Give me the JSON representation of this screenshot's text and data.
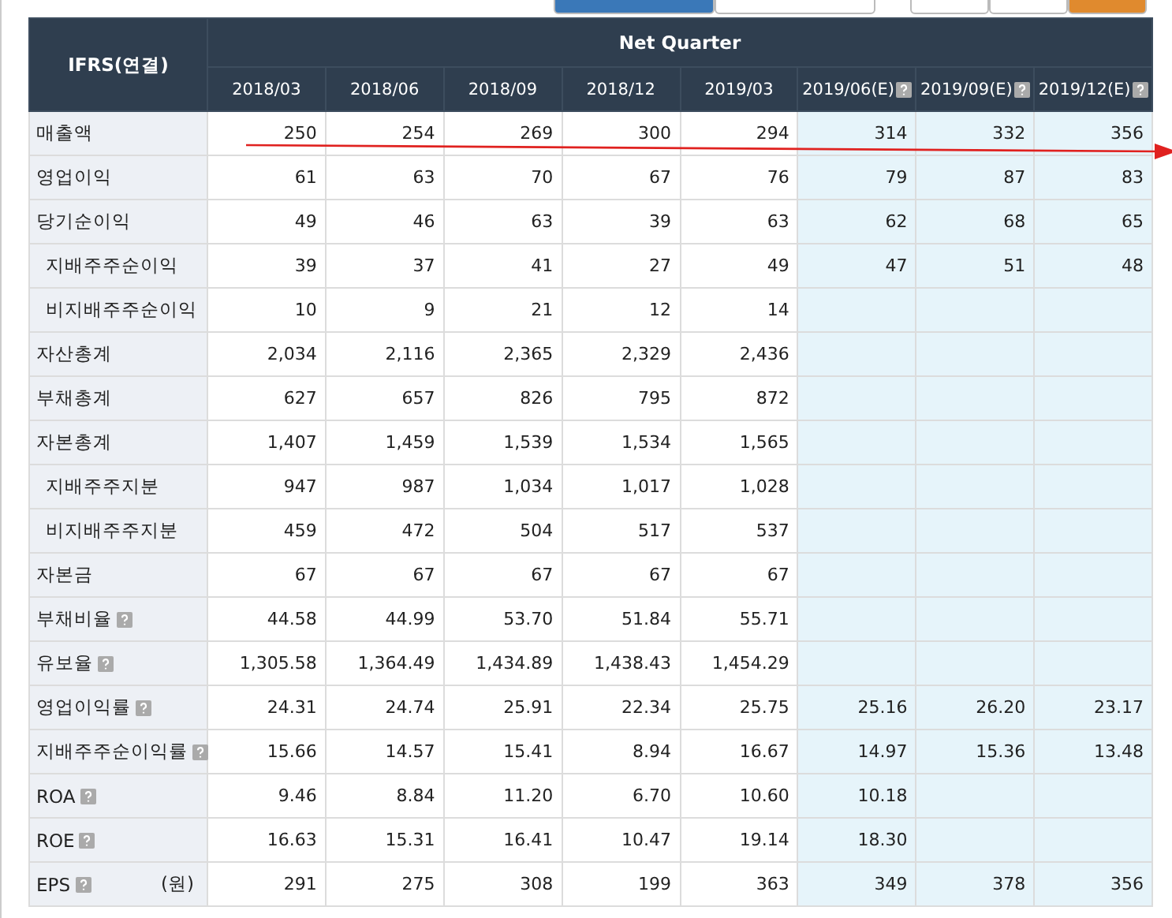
{
  "top_bar": {
    "view_buttons": [
      {
        "selected": true
      },
      {
        "selected": false
      }
    ],
    "period_buttons": [
      {
        "selected": false
      },
      {
        "selected": false
      },
      {
        "selected": true
      }
    ]
  },
  "table": {
    "corner": "IFRS(연결)",
    "group": "Net Quarter",
    "columns": [
      {
        "label": "2018/03",
        "estimate": false,
        "help": false
      },
      {
        "label": "2018/06",
        "estimate": false,
        "help": false
      },
      {
        "label": "2018/09",
        "estimate": false,
        "help": false
      },
      {
        "label": "2018/12",
        "estimate": false,
        "help": false
      },
      {
        "label": "2019/03",
        "estimate": false,
        "help": false
      },
      {
        "label": "2019/06(E)",
        "estimate": true,
        "help": true
      },
      {
        "label": "2019/09(E)",
        "estimate": true,
        "help": true
      },
      {
        "label": "2019/12(E)",
        "estimate": true,
        "help": true
      }
    ],
    "rows": [
      {
        "label": "매출액",
        "help": false,
        "values": [
          "250",
          "254",
          "269",
          "300",
          "294",
          "314",
          "332",
          "356"
        ]
      },
      {
        "label": "영업이익",
        "help": false,
        "values": [
          "61",
          "63",
          "70",
          "67",
          "76",
          "79",
          "87",
          "83"
        ]
      },
      {
        "label": "당기순이익",
        "help": false,
        "values": [
          "49",
          "46",
          "63",
          "39",
          "63",
          "62",
          "68",
          "65"
        ],
        "children": [
          {
            "label": "지배주주순이익",
            "help": false,
            "values": [
              "39",
              "37",
              "41",
              "27",
              "49",
              "47",
              "51",
              "48"
            ]
          },
          {
            "label": "비지배주주순이익",
            "help": false,
            "values": [
              "10",
              "9",
              "21",
              "12",
              "14"
            ]
          }
        ]
      },
      {
        "label": "자산총계",
        "help": false,
        "values": [
          "2,034",
          "2,116",
          "2,365",
          "2,329",
          "2,436"
        ]
      },
      {
        "label": "부채총계",
        "help": false,
        "values": [
          "627",
          "657",
          "826",
          "795",
          "872"
        ]
      },
      {
        "label": "자본총계",
        "help": false,
        "values": [
          "1,407",
          "1,459",
          "1,539",
          "1,534",
          "1,565"
        ],
        "children": [
          {
            "label": "지배주주지분",
            "help": false,
            "values": [
              "947",
              "987",
              "1,034",
              "1,017",
              "1,028"
            ]
          },
          {
            "label": "비지배주주지분",
            "help": false,
            "values": [
              "459",
              "472",
              "504",
              "517",
              "537"
            ]
          }
        ]
      },
      {
        "label": "자본금",
        "help": false,
        "values": [
          "67",
          "67",
          "67",
          "67",
          "67"
        ]
      },
      {
        "label": "부채비율",
        "help": true,
        "values": [
          "44.58",
          "44.99",
          "53.70",
          "51.84",
          "55.71"
        ]
      },
      {
        "label": "유보율",
        "help": true,
        "values": [
          "1,305.58",
          "1,364.49",
          "1,434.89",
          "1,438.43",
          "1,454.29"
        ]
      },
      {
        "label": "영업이익률",
        "help": true,
        "values": [
          "24.31",
          "24.74",
          "25.91",
          "22.34",
          "25.75",
          "25.16",
          "26.20",
          "23.17"
        ]
      },
      {
        "label": "지배주주순이익률",
        "help": true,
        "values": [
          "15.66",
          "14.57",
          "15.41",
          "8.94",
          "16.67",
          "14.97",
          "15.36",
          "13.48"
        ]
      },
      {
        "label": "ROA",
        "help": true,
        "values": [
          "9.46",
          "8.84",
          "11.20",
          "6.70",
          "10.60",
          "10.18"
        ]
      },
      {
        "label": "ROE",
        "help": true,
        "values": [
          "16.63",
          "15.31",
          "16.41",
          "10.47",
          "19.14",
          "18.30"
        ]
      },
      {
        "label": "EPS",
        "help": true,
        "unit": "(원)",
        "values": [
          "291",
          "275",
          "308",
          "199",
          "363",
          "349",
          "378",
          "356"
        ]
      }
    ]
  }
}
